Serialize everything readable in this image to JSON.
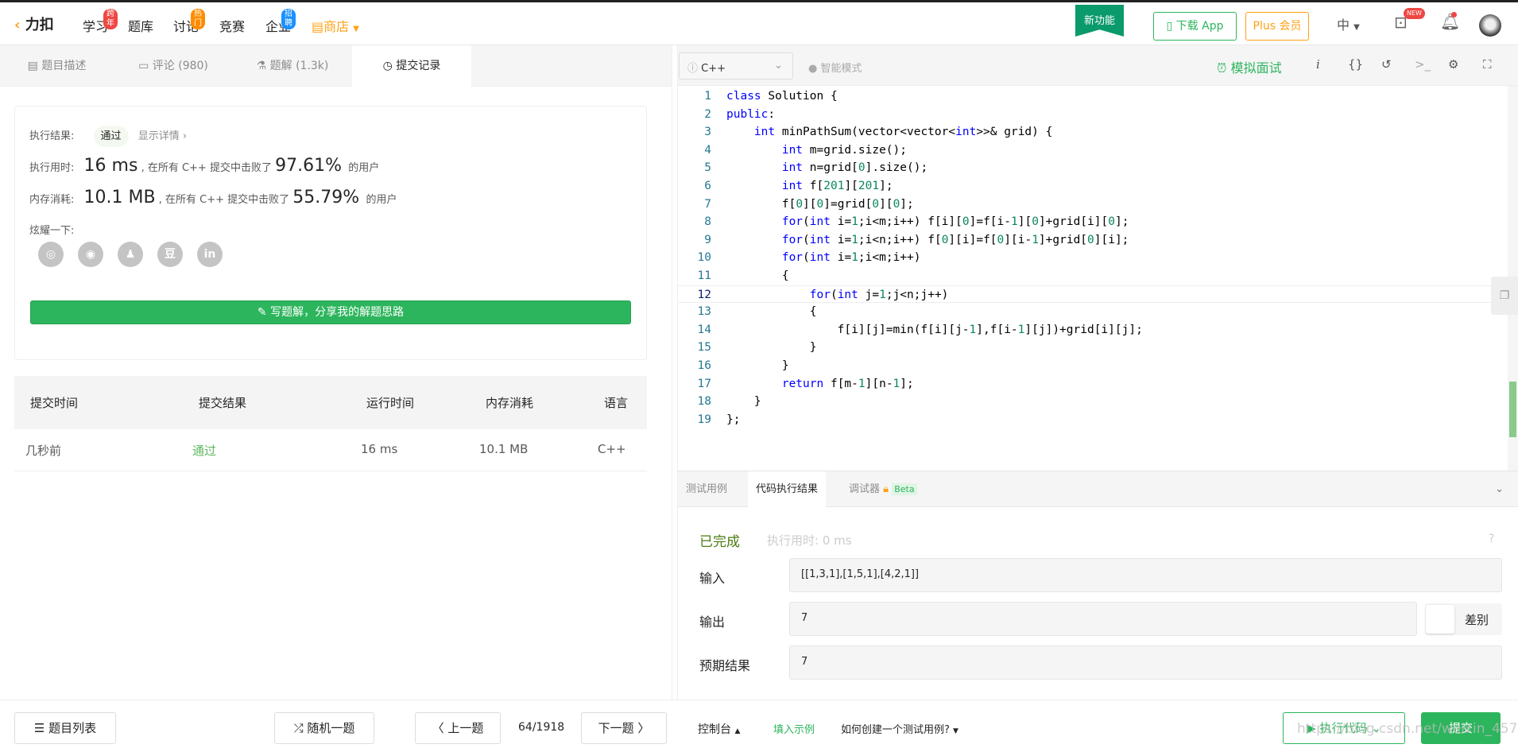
{
  "nav": {
    "logo": "力扣",
    "items": [
      {
        "label": "学习",
        "badge": "跨年",
        "badge_color": "#ef4743"
      },
      {
        "label": "题库"
      },
      {
        "label": "讨论",
        "badge": "热门",
        "badge_color": "#ff8c00"
      },
      {
        "label": "竞赛"
      },
      {
        "label": "企业",
        "badge": "招聘",
        "badge_color": "#1890ff"
      },
      {
        "label": "商店"
      }
    ],
    "new_feature": "新功能",
    "download": "下载 App",
    "plus": "Plus 会员",
    "lang": "中",
    "new_badge": "NEW"
  },
  "left_tabs": [
    {
      "label": "题目描述",
      "icon": "doc-icon"
    },
    {
      "label": "评论 (980)",
      "icon": "comment-icon"
    },
    {
      "label": "题解 (1.3k)",
      "icon": "flask-icon"
    },
    {
      "label": "提交记录",
      "icon": "clock-icon"
    }
  ],
  "result": {
    "label": "执行结果:",
    "status": "通过",
    "details": "显示详情 ›",
    "time_label": "执行用时:",
    "time": "16 ms",
    "mid": ", 在所有 C++ 提交中击败了",
    "time_pct": "97.61%",
    "suffix": "的用户",
    "mem_label": "内存消耗:",
    "mem": "10.1 MB",
    "mem_pct": "55.79%",
    "share_label": "炫耀一下:",
    "share": [
      "wechat",
      "weibo",
      "qq",
      "douban",
      "linkedin"
    ],
    "write": "写题解，分享我的解题思路"
  },
  "table": {
    "headers": [
      "提交时间",
      "提交结果",
      "运行时间",
      "内存消耗",
      "语言"
    ],
    "rows": [
      [
        "几秒前",
        "通过",
        "16 ms",
        "10.1 MB",
        "C++"
      ]
    ]
  },
  "editor": {
    "language": "C++",
    "smart_mode": "智能模式",
    "mock": "模拟面试",
    "code": [
      "class Solution {",
      "public:",
      "    int minPathSum(vector<vector<int>>& grid) {",
      "        int m=grid.size();",
      "        int n=grid[0].size();",
      "        int f[201][201];",
      "        f[0][0]=grid[0][0];",
      "        for(int i=1;i<m;i++) f[i][0]=f[i-1][0]+grid[i][0];",
      "        for(int i=1;i<n;i++) f[0][i]=f[0][i-1]+grid[0][i];",
      "        for(int i=1;i<m;i++)",
      "        {",
      "            for(int j=1;j<n;j++)",
      "            {",
      "                f[i][j]=min(f[i][j-1],f[i-1][j])+grid[i][j];",
      "            }",
      "        }",
      "        return f[m-1][n-1];",
      "    }",
      "};"
    ]
  },
  "console": {
    "tabs": [
      "测试用例",
      "代码执行结果",
      "调试器"
    ],
    "beta": "Beta",
    "done": "已完成",
    "exec_time": "执行用时: 0 ms",
    "input_label": "输入",
    "input": "[[1,3,1],[1,5,1],[4,2,1]]",
    "output_label": "输出",
    "output": "7",
    "diff": "差别",
    "expected_label": "预期结果",
    "expected": "7"
  },
  "footer": {
    "list": "题目列表",
    "random": "随机一题",
    "prev": "上一题",
    "page": "64/1918",
    "next": "下一题",
    "console": "控制台",
    "fill": "填入示例",
    "howto": "如何创建一个测试用例?",
    "run": "执行代码",
    "submit": "提交",
    "watermark": "https://blog.csdn.net/weixin_45774972"
  }
}
